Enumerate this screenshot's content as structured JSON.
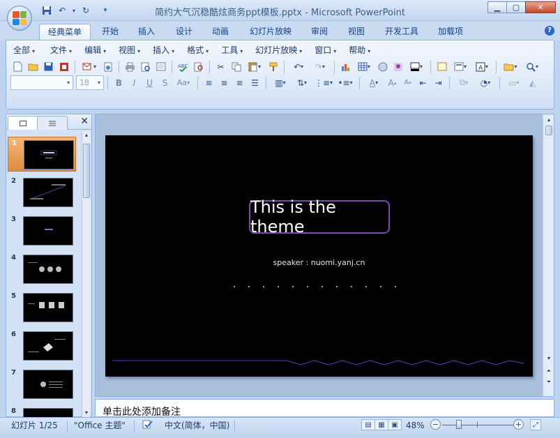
{
  "window": {
    "title": "简约大气沉稳酷炫商务ppt模板.pptx - Microsoft PowerPoint"
  },
  "quick_access": [
    {
      "icon": "save-icon",
      "glyph": "💾"
    },
    {
      "icon": "undo-icon",
      "glyph": "↶"
    },
    {
      "icon": "dropdown-icon",
      "glyph": "▾"
    },
    {
      "icon": "redo-icon",
      "glyph": "↻"
    },
    {
      "icon": "customize-icon",
      "glyph": "▾"
    }
  ],
  "tabs": [
    "经典菜单",
    "开始",
    "插入",
    "设计",
    "动画",
    "幻灯片放映",
    "审阅",
    "视图",
    "开发工具",
    "加载项"
  ],
  "active_tab": "经典菜单",
  "classic_menu": [
    "全部",
    "文件",
    "编辑",
    "视图",
    "插入",
    "格式",
    "工具",
    "幻灯片放映",
    "窗口",
    "帮助"
  ],
  "font_combo": {
    "font": "",
    "size": "18"
  },
  "left_panel": {
    "tab_slides_icon": "slides-tab-icon",
    "tab_outline_icon": "outline-tab-icon",
    "close_glyph": "✕"
  },
  "thumbnails": [
    {
      "num": "1",
      "selected": true
    },
    {
      "num": "2",
      "selected": false
    },
    {
      "num": "3",
      "selected": false
    },
    {
      "num": "4",
      "selected": false
    },
    {
      "num": "5",
      "selected": false
    },
    {
      "num": "6",
      "selected": false
    },
    {
      "num": "7",
      "selected": false
    },
    {
      "num": "8",
      "selected": false
    }
  ],
  "slide": {
    "title": "This is the theme",
    "speaker": "speaker : nuomi.yanj.cn",
    "dot_count": 12
  },
  "notes": {
    "placeholder": "单击此处添加备注"
  },
  "status": {
    "slide_count": "幻灯片 1/25",
    "theme": "\"Office 主题\"",
    "language": "中文(简体，中国)",
    "zoom": "48%",
    "zoom_level": 0.48
  },
  "colors": {
    "ribbon_blue": "#15428b",
    "selected_thumb": "#e08b3c",
    "slide_bg": "#000000",
    "title_border": "#7a4bb0",
    "wave_line": "#5a3bd0"
  }
}
